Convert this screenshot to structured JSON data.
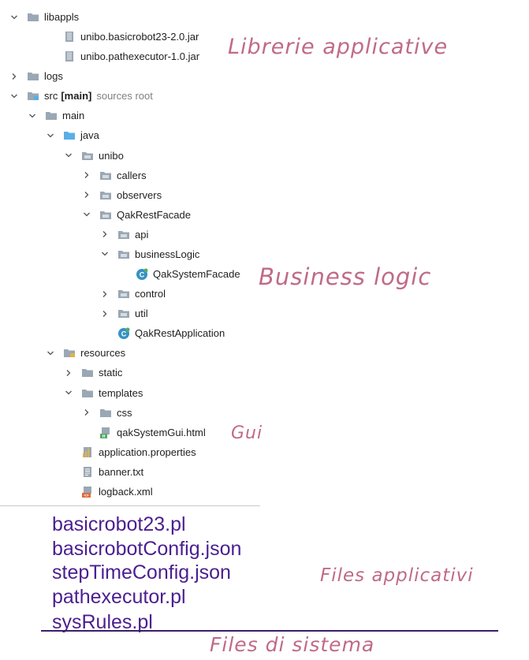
{
  "tree": [
    {
      "label": "libappls",
      "indent": 0,
      "chevron": "down",
      "icon": "folder"
    },
    {
      "label": "unibo.basicrobot23-2.0.jar",
      "indent": 2,
      "chevron": "none",
      "icon": "jar"
    },
    {
      "label": "unibo.pathexecutor-1.0.jar",
      "indent": 2,
      "chevron": "none",
      "icon": "jar"
    },
    {
      "label": "logs",
      "indent": 0,
      "chevron": "right",
      "icon": "folder"
    },
    {
      "label": "src",
      "bold": "[main]",
      "suffix": "sources root",
      "indent": 0,
      "chevron": "down",
      "icon": "src-folder"
    },
    {
      "label": "main",
      "indent": 1,
      "chevron": "down",
      "icon": "folder"
    },
    {
      "label": "java",
      "indent": 2,
      "chevron": "down",
      "icon": "source-folder"
    },
    {
      "label": "unibo",
      "indent": 3,
      "chevron": "down",
      "icon": "package"
    },
    {
      "label": "callers",
      "indent": 4,
      "chevron": "right",
      "icon": "package"
    },
    {
      "label": "observers",
      "indent": 4,
      "chevron": "right",
      "icon": "package"
    },
    {
      "label": "QakRestFacade",
      "indent": 4,
      "chevron": "down",
      "icon": "package"
    },
    {
      "label": "api",
      "indent": 5,
      "chevron": "right",
      "icon": "package"
    },
    {
      "label": "businessLogic",
      "indent": 5,
      "chevron": "down",
      "icon": "package"
    },
    {
      "label": "QakSystemFacade",
      "indent": 6,
      "chevron": "none",
      "icon": "class"
    },
    {
      "label": "control",
      "indent": 5,
      "chevron": "right",
      "icon": "package"
    },
    {
      "label": "util",
      "indent": 5,
      "chevron": "right",
      "icon": "package"
    },
    {
      "label": "QakRestApplication",
      "indent": 5,
      "chevron": "none",
      "icon": "class"
    },
    {
      "label": "resources",
      "indent": 2,
      "chevron": "down",
      "icon": "resources-folder"
    },
    {
      "label": "static",
      "indent": 3,
      "chevron": "right",
      "icon": "folder"
    },
    {
      "label": "templates",
      "indent": 3,
      "chevron": "down",
      "icon": "folder"
    },
    {
      "label": "css",
      "indent": 4,
      "chevron": "right",
      "icon": "folder"
    },
    {
      "label": "qakSystemGui.html",
      "indent": 4,
      "chevron": "none",
      "icon": "html"
    },
    {
      "label": "application.properties",
      "indent": 3,
      "chevron": "none",
      "icon": "properties"
    },
    {
      "label": "banner.txt",
      "indent": 3,
      "chevron": "none",
      "icon": "text"
    },
    {
      "label": "logback.xml",
      "indent": 3,
      "chevron": "none",
      "icon": "xml"
    }
  ],
  "annotations": {
    "libraries": "Librerie applicative",
    "business": "Business logic",
    "gui": "Gui",
    "app_files": "Files applicativi",
    "sys_files": "Files di sistema"
  },
  "files": {
    "applicative": [
      "basicrobot23.pl",
      "basicrobotConfig.json",
      "stepTimeConfig.json",
      "pathexecutor.pl"
    ],
    "system": [
      "sysRules.pl"
    ]
  },
  "colors": {
    "annotation": "#c06a88",
    "file_text": "#4b1f8f",
    "folder": "#9aa7b4",
    "source_folder": "#5aaee6"
  }
}
